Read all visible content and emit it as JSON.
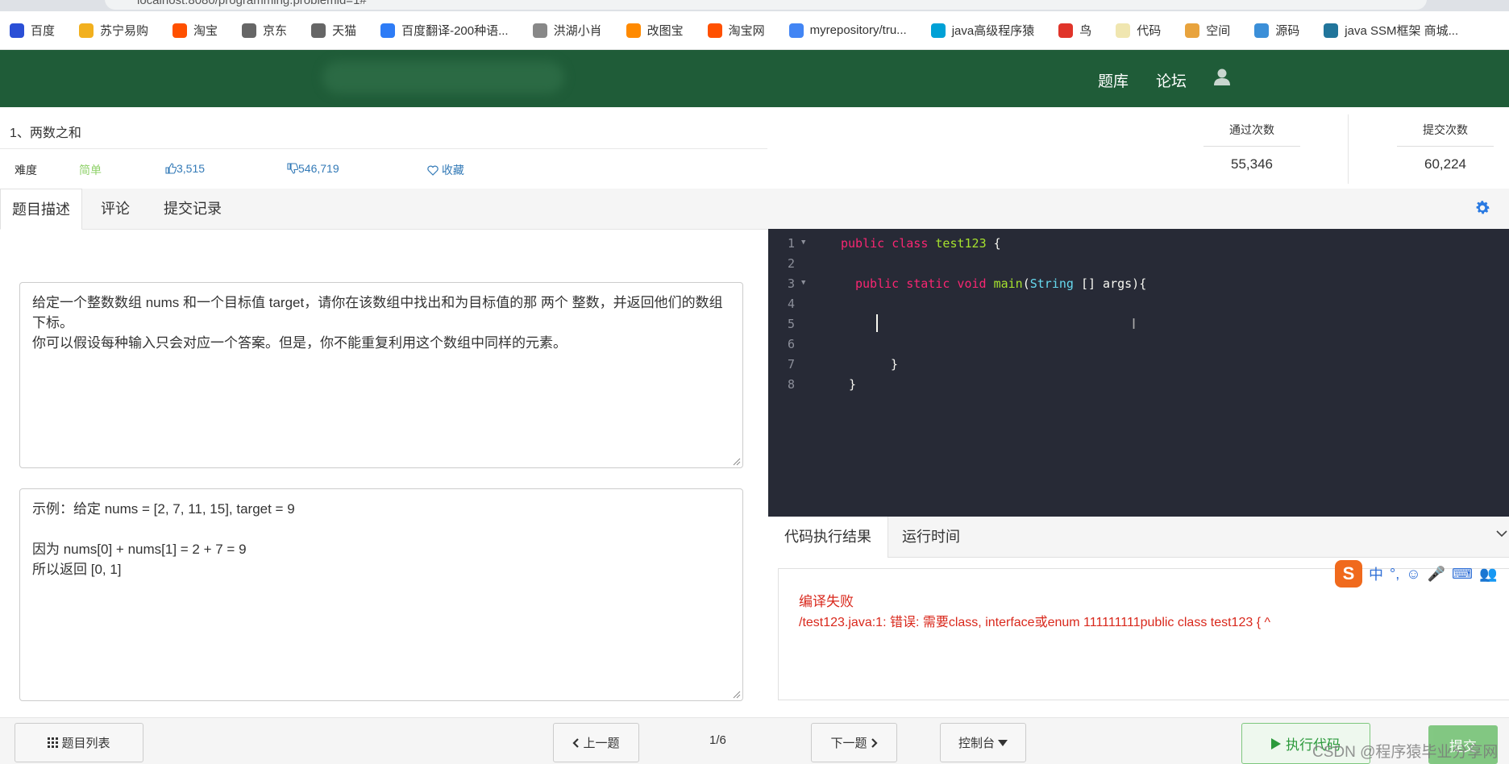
{
  "browser": {
    "url": "localhost:8080/programming.problemid=1#"
  },
  "bookmarks": [
    {
      "label": "百度",
      "color": "#2b4fd6"
    },
    {
      "label": "苏宁易购",
      "color": "#f2b01e"
    },
    {
      "label": "淘宝",
      "color": "#ff5000"
    },
    {
      "label": "京东",
      "color": "#666666"
    },
    {
      "label": "天猫",
      "color": "#666666"
    },
    {
      "label": "百度翻译-200种语...",
      "color": "#2e7cf6"
    },
    {
      "label": "洪湖小肖",
      "color": "#888888"
    },
    {
      "label": "改图宝",
      "color": "#ff8a00"
    },
    {
      "label": "淘宝网",
      "color": "#ff5000"
    },
    {
      "label": "myrepository/tru...",
      "color": "#4285f4"
    },
    {
      "label": "java高级程序猿",
      "color": "#00a1d6"
    },
    {
      "label": "鸟",
      "color": "#e0342a"
    },
    {
      "label": "代码",
      "color": "#f0e6b0"
    },
    {
      "label": "空间",
      "color": "#e8a33d"
    },
    {
      "label": "源码",
      "color": "#3b8fd8"
    },
    {
      "label": "java SSM框架 商城...",
      "color": "#21759b"
    }
  ],
  "nav": {
    "problems": "题库",
    "forum": "论坛"
  },
  "problem": {
    "title": "1、两数之和",
    "difficulty_label": "难度",
    "difficulty": "简单",
    "likes": "3,515",
    "dislikes": "546,719",
    "favorite": "收藏",
    "pass_label": "通过次数",
    "pass_count": "55,346",
    "submit_label": "提交次数",
    "submit_count": "60,224"
  },
  "tabs": [
    "题目描述",
    "评论",
    "提交记录"
  ],
  "description": {
    "line1": "给定一个整数数组 nums 和一个目标值 target，请你在该数组中找出和为目标值的那 两个 整数，并返回他们的数组下标。",
    "line2": "你可以假设每种输入只会对应一个答案。但是，你不能重复利用这个数组中同样的元素。"
  },
  "example": {
    "line1": "示例：给定 nums = [2, 7, 11, 15], target = 9",
    "line2": "因为 nums[0] + nums[1] = 2 + 7 = 9",
    "line3": "所以返回 [0, 1]"
  },
  "editor": {
    "lines": [
      "1",
      "2",
      "3",
      "4",
      "5",
      "6",
      "7",
      "8"
    ],
    "code": {
      "l1_kw": "public class",
      "l1_name": "test123",
      "l1_rest": " {",
      "l3_kw": "public static void",
      "l3_fn": "main",
      "l3_type": "String",
      "l3_rest": " [] args){",
      "l7": "}",
      "l8": "}"
    }
  },
  "result": {
    "tab1": "代码执行结果",
    "tab2": "运行时间",
    "error_title": "编译失败",
    "error_msg": "/test123.java:1: 错误: 需要class, interface或enum 111111111public class test123 { ^"
  },
  "ime": {
    "logo": "S",
    "items": [
      "中",
      "°,",
      "☺",
      "🎤",
      "⌨",
      "👥"
    ]
  },
  "footer": {
    "problem_list": "题目列表",
    "prev": "上一题",
    "page": "1/6",
    "next": "下一题",
    "console": "控制台",
    "run": "执行代码",
    "submit": "提交",
    "watermark": "CSDN @程序猿毕业分享网"
  }
}
